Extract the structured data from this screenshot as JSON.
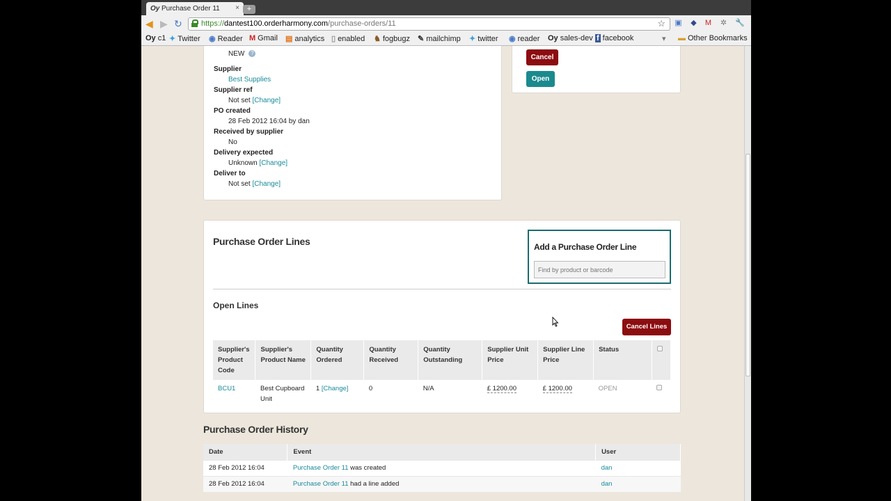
{
  "tab": {
    "title": "Purchase Order 11",
    "favicon": "oh-favicon",
    "close": "×",
    "new_tab": "+"
  },
  "toolbar": {
    "url_scheme": "https://",
    "url_host": "dantest100.orderharmony.com",
    "url_path": "/purchase-orders/11"
  },
  "bookmarks": [
    {
      "icon": "oh-favicon",
      "glyph": "Oy",
      "label": "c1"
    },
    {
      "icon": "twitter-icon",
      "glyph": "✦",
      "label": "Twitter"
    },
    {
      "icon": "reader-icon",
      "glyph": "◉",
      "label": "Reader"
    },
    {
      "icon": "gmail-icon",
      "glyph": "M",
      "label": "Gmail"
    },
    {
      "icon": "analytics-icon",
      "glyph": "▤",
      "label": "analytics"
    },
    {
      "icon": "page-icon",
      "glyph": "▯",
      "label": "enabled"
    },
    {
      "icon": "fogbugz-icon",
      "glyph": "♞",
      "label": "fogbugz"
    },
    {
      "icon": "mailchimp-icon",
      "glyph": "✎",
      "label": "mailchimp"
    },
    {
      "icon": "twitter-icon",
      "glyph": "✦",
      "label": "twitter"
    },
    {
      "icon": "reader-icon",
      "glyph": "◉",
      "label": "reader"
    },
    {
      "icon": "oh-favicon",
      "glyph": "Oy",
      "label": "sales-dev"
    },
    {
      "icon": "facebook-icon",
      "glyph": "f",
      "label": "facebook"
    }
  ],
  "bookmarks_other": "Other Bookmarks",
  "details": {
    "status_value": "NEW",
    "supplier_label": "Supplier",
    "supplier_value": "Best Supplies",
    "supplier_ref_label": "Supplier ref",
    "supplier_ref_value": "Not set",
    "change": "[Change]",
    "po_created_label": "PO created",
    "po_created_value": "28 Feb 2012 16:04 by dan",
    "received_label": "Received by supplier",
    "received_value": "No",
    "delivery_label": "Delivery expected",
    "delivery_value": "Unknown",
    "deliver_to_label": "Deliver to",
    "deliver_to_value": "Not set"
  },
  "actions": {
    "cancel": "Cancel",
    "open": "Open"
  },
  "lines_section": {
    "title": "Purchase Order Lines",
    "add_title": "Add a Purchase Order Line",
    "add_placeholder": "Find by product or barcode",
    "open_lines_title": "Open Lines",
    "cancel_lines": "Cancel Lines",
    "headers": [
      "Supplier's Product Code",
      "Supplier's Product Name",
      "Quantity Ordered",
      "Quantity Received",
      "Quantity Outstanding",
      "Supplier Unit Price",
      "Supplier Line Price",
      "Status"
    ],
    "rows": [
      {
        "code": "BCU1",
        "name": "Best Cupboard Unit",
        "ordered": "1",
        "received": "0",
        "outstanding": "N/A",
        "unit_price": "£ 1200.00",
        "line_price": "£ 1200.00",
        "status": "OPEN"
      }
    ]
  },
  "history": {
    "title": "Purchase Order History",
    "headers": [
      "Date",
      "Event",
      "User"
    ],
    "rows": [
      {
        "date": "28 Feb 2012 16:04",
        "event_link": "Purchase Order 11",
        "event_text": " was created",
        "user": "dan"
      },
      {
        "date": "28 Feb 2012 16:04",
        "event_link": "Purchase Order 11",
        "event_text": " had a line added",
        "user": "dan"
      }
    ]
  },
  "colors": {
    "brand_red": "#8c0d10",
    "brand_teal": "#1a8a8e",
    "link": "#1a8a9a",
    "page_bg": "#ece6dc"
  }
}
